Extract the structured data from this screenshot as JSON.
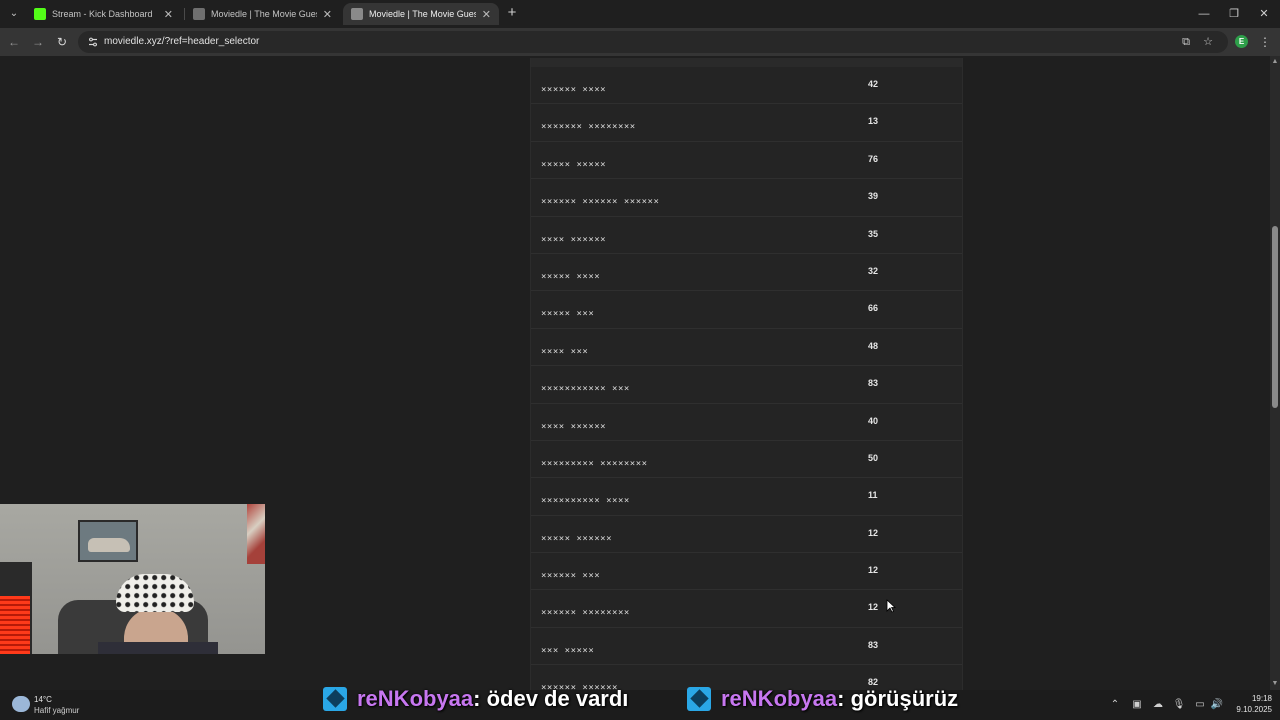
{
  "browser": {
    "tabs": [
      {
        "label": "Stream - Kick Dashboard",
        "favicon_color": "#53fc18",
        "active": false
      },
      {
        "label": "Moviedle | The Movie Guessing",
        "favicon_color": "#8a8a8a",
        "active": false
      },
      {
        "label": "Moviedle | The Movie Guessing",
        "favicon_color": "#8a8a8a",
        "active": true
      }
    ],
    "url": "moviedle.xyz/?ref=header_selector",
    "profile_initial": "E"
  },
  "results": {
    "rows": [
      {
        "title": "×××××× ××××",
        "score": "42"
      },
      {
        "title": "××××××× ××××××××",
        "score": "13"
      },
      {
        "title": "××××× ×××××",
        "score": "76"
      },
      {
        "title": "×××××× ×××××× ××××××",
        "score": "39"
      },
      {
        "title": "×××× ××××××",
        "score": "35"
      },
      {
        "title": "××××× ××××",
        "score": "32"
      },
      {
        "title": "××××× ×××",
        "score": "66"
      },
      {
        "title": "×××× ×××",
        "score": "48"
      },
      {
        "title": "××××××××××× ×××",
        "score": "83"
      },
      {
        "title": "×××× ××××××",
        "score": "40"
      },
      {
        "title": "××××××××× ××××××××",
        "score": "50"
      },
      {
        "title": "×××××××××× ××××",
        "score": "11"
      },
      {
        "title": "××××× ××××××",
        "score": "12"
      },
      {
        "title": "×××××× ×××",
        "score": "12"
      },
      {
        "title": "×××××× ××××××××",
        "score": "12"
      },
      {
        "title": "××× ×××××",
        "score": "83"
      },
      {
        "title": "×××××× ××××××",
        "score": "82"
      }
    ]
  },
  "chat": [
    {
      "user": "reNKobyaa",
      "message": ": ödev de vardı"
    },
    {
      "user": "reNKobyaa",
      "message": ": görüşürüz"
    }
  ],
  "taskbar": {
    "temperature": "14°C",
    "weather": "Hafif yağmur",
    "time": "19:18",
    "date": "9.10.2025"
  },
  "colors": {
    "chat_username": "#c777f0",
    "kick_green": "#53fc18",
    "badge_blue": "#2aa7e6"
  }
}
